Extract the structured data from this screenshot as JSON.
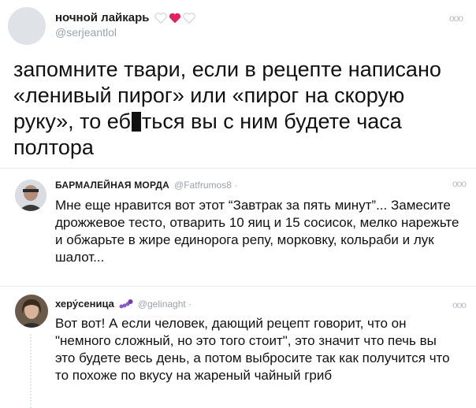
{
  "main_tweet": {
    "display_name": "ночной лайкарь",
    "handle": "@serjeantlol",
    "text_before_censor": "запомните твари, если в рецепте написано «ленивый пирог» или «пирог на скорую руку», то еб",
    "text_after_censor": "ться вы с ним будете часа полтора"
  },
  "replies": [
    {
      "display_name": "БАРМАЛЕЙНАЯ МОРДА",
      "handle": "@Fatfrumos8 ·",
      "text": "Мне еще нравится вот этот “Завтрак за пять минут”... Замесите дрожжевое тесто, отварить 10 яиц и 15 сосисок, мелко нарежьте и обжарьте в жире единорога репу, морковку, кольраби и лук шалот..."
    },
    {
      "display_name": "херу́сеница",
      "handle": "@gelinaght ·",
      "text": "Вот вот! А если человек, дающий рецепт говорит, что он \"немного сложный, но это того стоит\", это значит что печь вы это будете весь день,  а потом выбросите так как получится что то похоже по вкусу на жареный чайный гриб"
    }
  ],
  "more_glyph": "ooo",
  "colors": {
    "heart_red": "#e0245e",
    "heart_outline": "#d4d8dc",
    "name_text": "#1c1c1c",
    "handle_text": "#9aa3ab",
    "divider": "#e6ecf0",
    "caterpillar": "#8b5cc7"
  }
}
